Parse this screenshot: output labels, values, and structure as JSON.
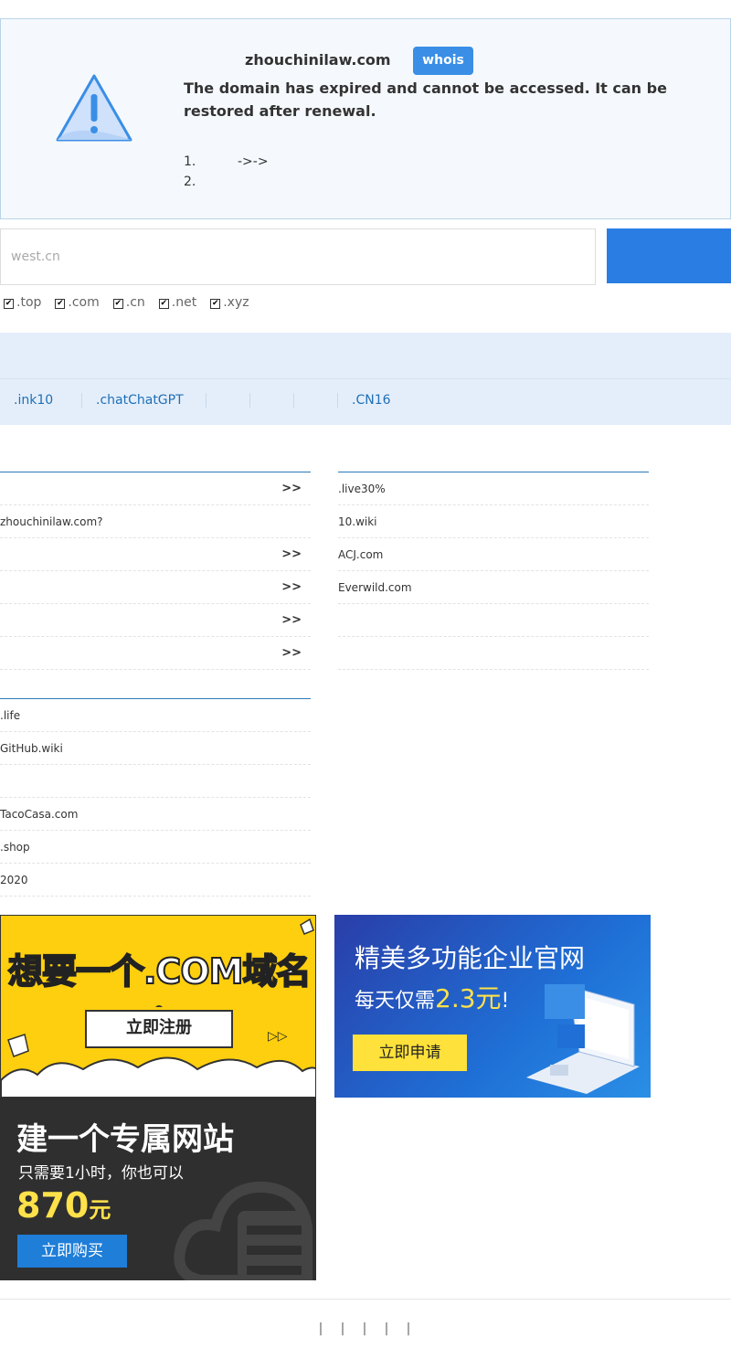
{
  "expired": {
    "domain": "zhouchinilaw.com",
    "whois_label": "whois",
    "message": "The domain has expired and cannot be accessed. It can be restored after renewal.",
    "steps": [
      {
        "num": "1.",
        "text": "->->"
      },
      {
        "num": "2.",
        "text": ""
      }
    ]
  },
  "search": {
    "placeholder": "west.cn",
    "button_label": ""
  },
  "tlds": [
    ".top",
    ".com",
    ".cn",
    ".net",
    ".xyz"
  ],
  "promo_links": [
    ".ink10",
    ".chatChatGPT",
    "",
    "",
    "",
    ".CN16"
  ],
  "left_list_1": [
    {
      "text": "",
      "more": ">>"
    },
    {
      "text": "zhouchinilaw.com?",
      "more": ""
    },
    {
      "text": "",
      "more": ">>"
    },
    {
      "text": "",
      "more": ">>"
    },
    {
      "text": "",
      "more": ">>"
    },
    {
      "text": "",
      "more": ">>"
    }
  ],
  "right_list": [
    ".live30%",
    "10.wiki",
    "ACJ.com",
    "Everwild.com",
    "",
    ""
  ],
  "left_list_2": [
    ".life",
    "GitHub.wiki",
    "",
    "TacoCasa.com",
    ".shop",
    "2020"
  ],
  "banners": {
    "com_domain": {
      "title": "想要一个.COM域名",
      "button": "立即注册",
      "arrows": "▷▷"
    },
    "enterprise": {
      "title": "精美多功能企业官网",
      "sub_prefix": "每天仅需",
      "price": "2.3元",
      "sub_suffix": "!",
      "button": "立即申请"
    },
    "website": {
      "title": "建一个专属网站",
      "sub": "只需要1小时，你也可以",
      "price": "870",
      "unit": "元",
      "button": "立即购买"
    }
  },
  "footer_links": [
    "|",
    "|",
    "|",
    "|",
    "|"
  ],
  "colors": {
    "accent": "#2a7ee3",
    "whois": "#3a8ee6",
    "link": "#1f6fb5",
    "banner_yellow": "#fecf0e"
  }
}
